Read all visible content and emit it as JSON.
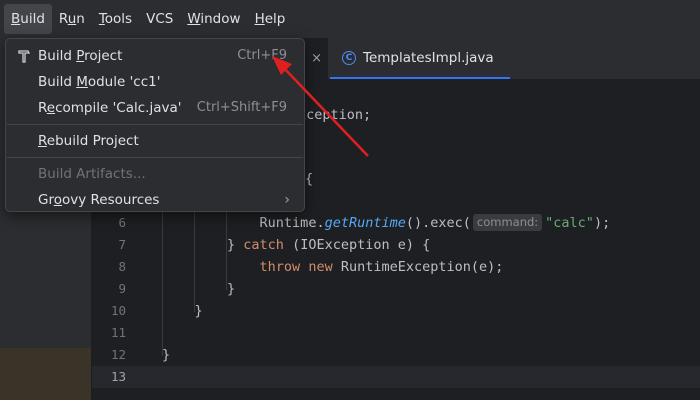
{
  "menubar": {
    "items": [
      {
        "label": "Build",
        "u": "B",
        "rest": "uild"
      },
      {
        "label": "Run",
        "pre": "R",
        "u": "u",
        "rest": "n"
      },
      {
        "label": "Tools",
        "u": "T",
        "rest": "ools"
      },
      {
        "label": "VCS",
        "u": "",
        "rest": "VCS"
      },
      {
        "label": "Window",
        "u": "W",
        "rest": "indow"
      },
      {
        "label": "Help",
        "u": "H",
        "rest": "elp"
      }
    ]
  },
  "tabs": {
    "tab1_close": "×",
    "tab2_label": "TemplatesImpl.java",
    "tab2_icon": "C"
  },
  "build_menu": {
    "build_project": {
      "pre": "Build ",
      "u": "P",
      "rest": "roject",
      "shortcut": "Ctrl+F9",
      "icon": "hammer-icon"
    },
    "build_module": {
      "pre": "Build ",
      "u": "M",
      "rest": "odule 'cc1'"
    },
    "recompile": {
      "pre": "R",
      "u": "e",
      "rest": "compile 'Calc.java'",
      "shortcut": "Ctrl+Shift+F9"
    },
    "rebuild": {
      "pre": "",
      "u": "R",
      "rest": "ebuild Project"
    },
    "build_artifacts": {
      "label": "Build Artifacts..."
    },
    "groovy": {
      "pre": "Gr",
      "u": "o",
      "rest": "ovy Resources",
      "arrow": "›"
    }
  },
  "editor": {
    "peek_line1": "xception;",
    "peek_line3": "{",
    "lines": [
      {
        "num": "6",
        "indent": "            ",
        "parts": [
          {
            "t": "Runtime."
          },
          {
            "t": "getRuntime",
            "c": "fn"
          },
          {
            "t": "().exec("
          },
          {
            "hint": "command:"
          },
          {
            "t": "\"calc\"",
            "c": "str"
          },
          {
            "t": ");"
          }
        ]
      },
      {
        "num": "7",
        "indent": "        ",
        "parts": [
          {
            "t": "} "
          },
          {
            "t": "catch",
            "c": "kw"
          },
          {
            "t": " (IOException e) {"
          }
        ]
      },
      {
        "num": "8",
        "indent": "            ",
        "parts": [
          {
            "t": "throw",
            "c": "kw"
          },
          {
            "t": " "
          },
          {
            "t": "new",
            "c": "kw"
          },
          {
            "t": " RuntimeException(e);"
          }
        ]
      },
      {
        "num": "9",
        "indent": "        ",
        "parts": [
          {
            "t": "}"
          }
        ]
      },
      {
        "num": "10",
        "indent": "    ",
        "parts": [
          {
            "t": "}"
          }
        ]
      },
      {
        "num": "11",
        "indent": "",
        "parts": []
      },
      {
        "num": "12",
        "indent": "",
        "parts": [
          {
            "t": "}"
          }
        ]
      },
      {
        "num": "13",
        "indent": "",
        "parts": [],
        "current": true
      }
    ]
  },
  "colors": {
    "annotation_arrow": "#e02020",
    "keyword": "#cf8e6d",
    "method": "#56a8f5",
    "string": "#6aab73"
  }
}
